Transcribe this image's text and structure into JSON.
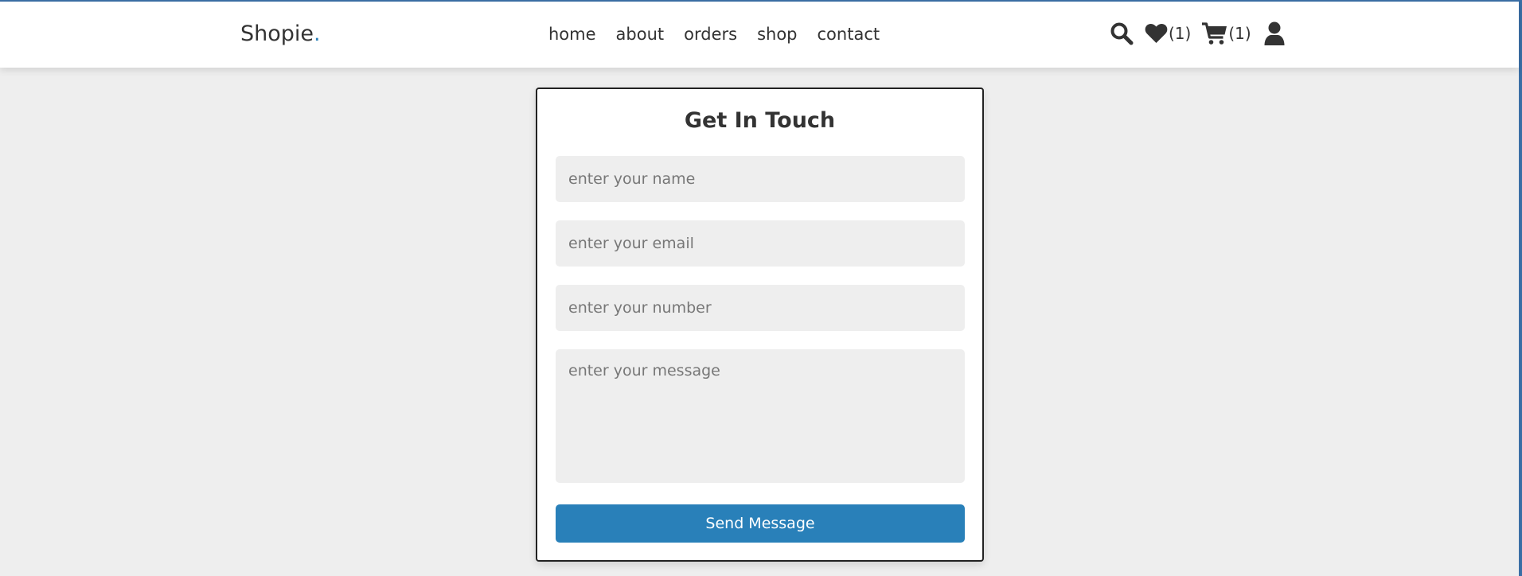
{
  "header": {
    "logo_text": "Shopie",
    "logo_dot": ".",
    "nav": [
      "home",
      "about",
      "orders",
      "shop",
      "contact"
    ],
    "wishlist_count": "(1)",
    "cart_count": "(1)"
  },
  "form": {
    "title": "Get In Touch",
    "name_placeholder": "enter your name",
    "email_placeholder": "enter your email",
    "number_placeholder": "enter your number",
    "message_placeholder": "enter your message",
    "submit_label": "Send Message"
  },
  "colors": {
    "accent": "#2980b9",
    "background": "#eeeeee",
    "text": "#333333"
  }
}
